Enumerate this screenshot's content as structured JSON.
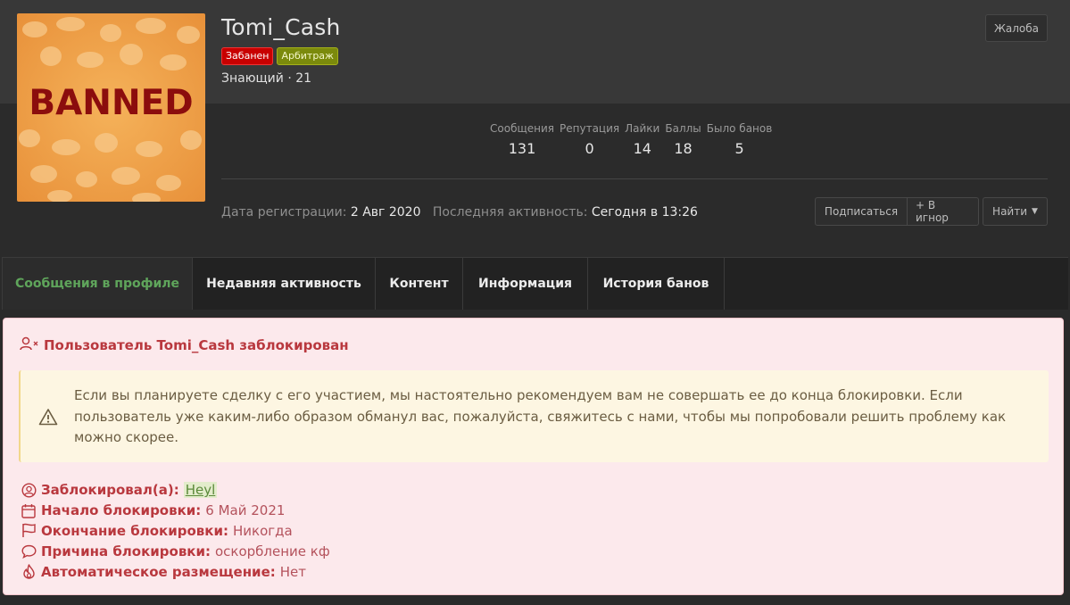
{
  "profile": {
    "username": "Tomi_Cash",
    "avatar_text": "BANNED",
    "badges": [
      "Забанен",
      "Арбитраж"
    ],
    "rank": "Знающий · 21",
    "report_label": "Жалоба"
  },
  "stats": [
    {
      "label": "Сообщения",
      "value": "131"
    },
    {
      "label": "Репутация",
      "value": "0"
    },
    {
      "label": "Лайки",
      "value": "14"
    },
    {
      "label": "Баллы",
      "value": "18"
    },
    {
      "label": "Было банов",
      "value": "5"
    }
  ],
  "meta": {
    "registered_label": "Дата регистрации:",
    "registered_value": "2 Авг 2020",
    "last_active_label": "Последняя активность:",
    "last_active_value": "Сегодня в 13:26"
  },
  "actions": {
    "subscribe": "Подписаться",
    "ignore": "+ В игнор",
    "find": "Найти"
  },
  "tabs": [
    "Сообщения в профиле",
    "Недавняя активность",
    "Контент",
    "Информация",
    "История банов"
  ],
  "ban": {
    "title": "Пользователь Tomi_Cash заблокирован",
    "warning": "Если вы планируете сделку с его участием, мы настоятельно рекомендуем вам не совершать ее до конца блокировки. Если пользователь уже каким-либо образом обманул вас, пожалуйста, свяжитесь с нами, чтобы мы попробовали решить проблему как можно скорее.",
    "banned_by_label": "Заблокировал(а):",
    "banned_by_value": "Heyl",
    "start_label": "Начало блокировки:",
    "start_value": "6 Май 2021",
    "end_label": "Окончание блокировки:",
    "end_value": "Никогда",
    "reason_label": "Причина блокировки:",
    "reason_value": "оскорбление кф",
    "auto_label": "Автоматическое размещение:",
    "auto_value": "Нет"
  },
  "colors": {
    "accent_green": "#5fa55b",
    "ban_red": "#b9383e",
    "badge_banned": "#c80000",
    "badge_arbitrage": "#7b8a0c"
  }
}
